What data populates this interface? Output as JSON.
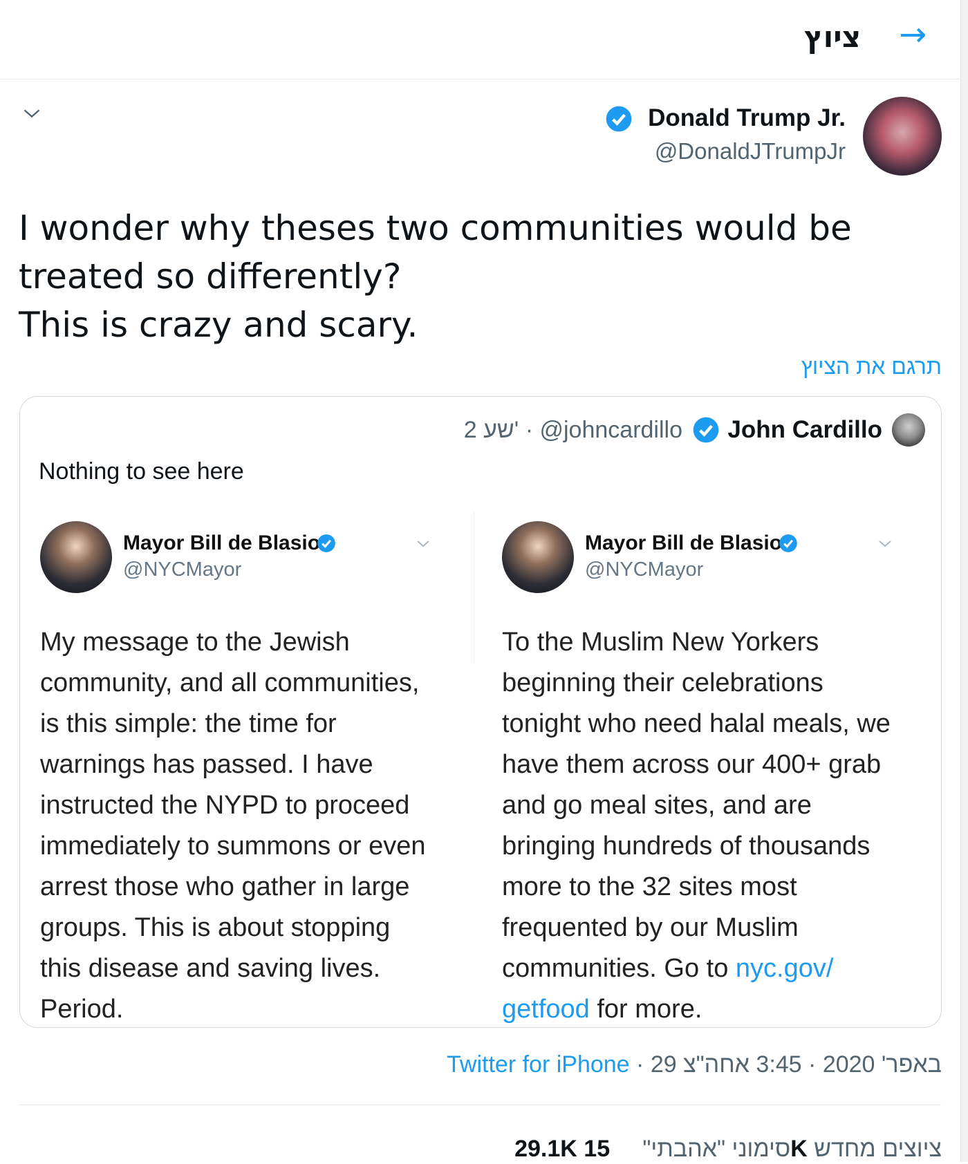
{
  "header": {
    "back_arrow": "→",
    "title": "ציוץ"
  },
  "author": {
    "name": "Donald Trump Jr.",
    "handle": "@DonaldJTrumpJr",
    "verified": true
  },
  "tweet": {
    "lines": [
      "I wonder why theses two communities would be",
      "treated so differently?",
      "This is crazy and scary."
    ],
    "translate_label": "תרגם את הציוץ"
  },
  "quote": {
    "name": "John Cardillo",
    "handle": "@johncardillo",
    "separator": "·",
    "time": "2 שע'",
    "text": "Nothing to see here",
    "left_panel": {
      "name": "Mayor Bill de Blasio",
      "handle": "@NYCMayor",
      "lines": [
        "My message to the Jewish",
        "community, and all communities,",
        "is this simple: the time for",
        "warnings has passed. I have",
        "instructed the NYPD to proceed",
        "immediately to summons or even",
        "arrest those who gather in large",
        "groups. This is about stopping",
        "this disease and saving lives.",
        "Period."
      ]
    },
    "right_panel": {
      "name": "Mayor Bill de Blasio",
      "handle": "@NYCMayor",
      "lines": [
        "To the Muslim New Yorkers",
        "beginning their celebrations",
        "tonight who need halal meals, we",
        "have them across our 400+ grab",
        "and go meal sites, and are",
        "bringing hundreds of thousands",
        "more to the 32 sites most",
        "frequented by our Muslim"
      ],
      "line9_prefix": "communities. Go to ",
      "link_part1": "nyc.gov/",
      "link_part2": "getfood",
      "line10_suffix": " for more."
    }
  },
  "meta": {
    "time": "3:45 אחה\"צ",
    "date": "29 באפר' 2020",
    "separator": "·",
    "source": "Twitter for iPhone"
  },
  "stats": {
    "retweets_value": "15K",
    "retweets_label": "ציוצים מחדש",
    "likes_value": "29.1K",
    "likes_label": "סימוני \"אהבתי\""
  },
  "colors": {
    "accent": "#1d9bf0",
    "text": "#0f1419",
    "muted": "#536471",
    "border": "#cfd9de"
  }
}
